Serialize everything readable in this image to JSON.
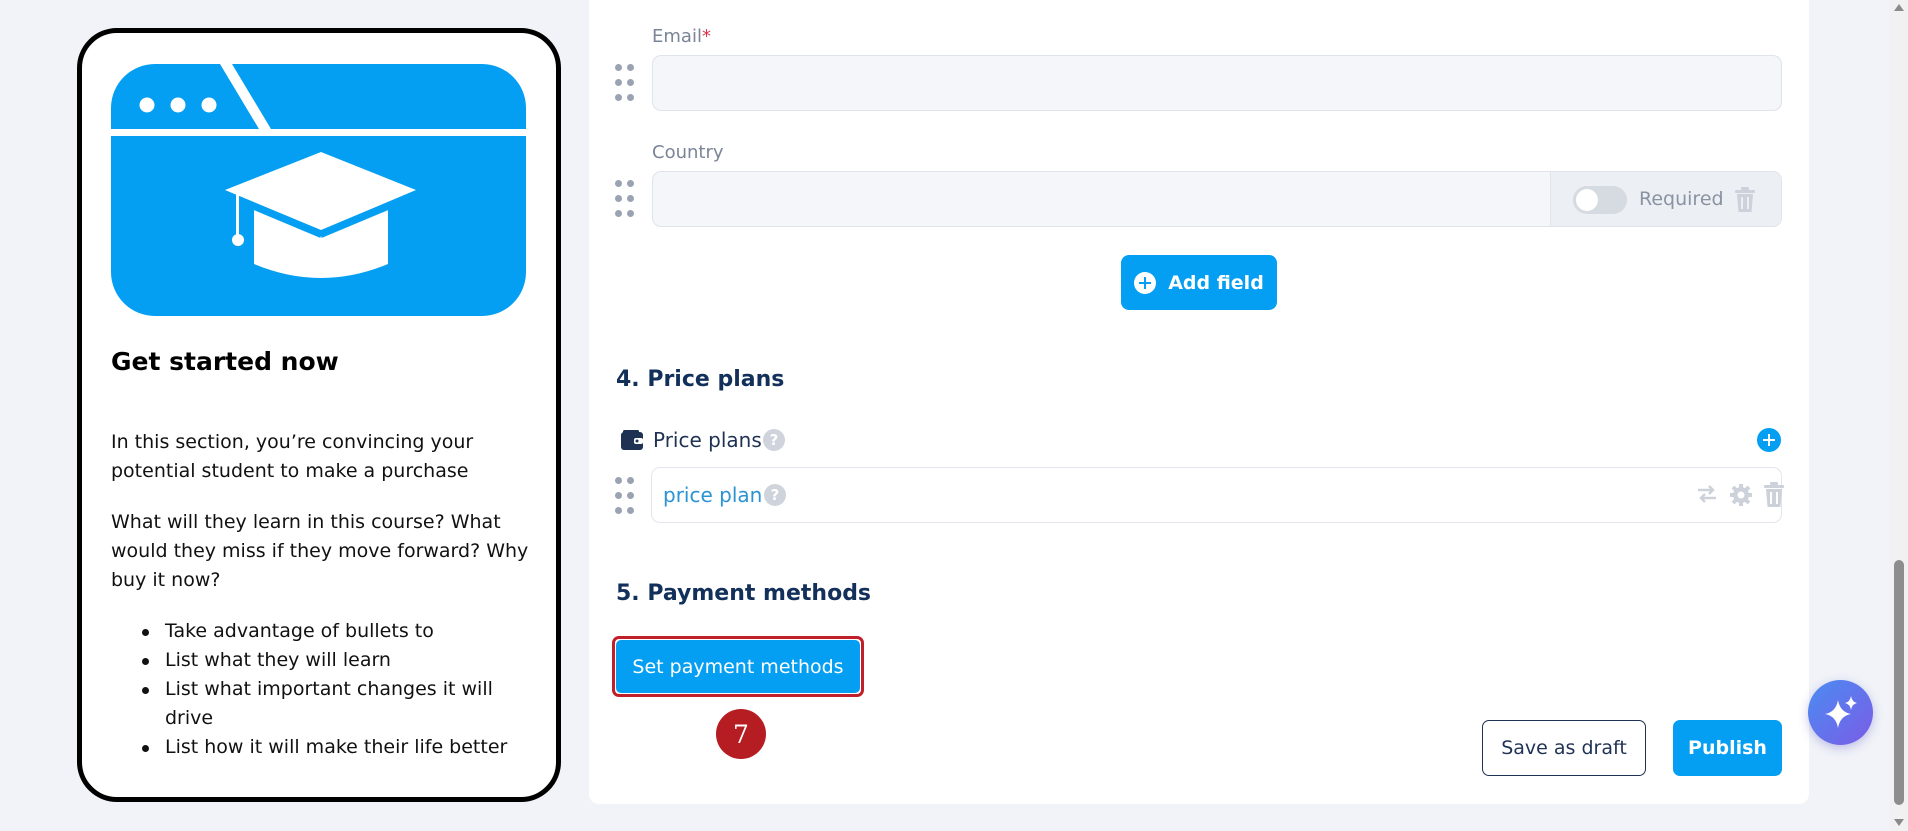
{
  "preview": {
    "title": "Get started now",
    "paragraph_1": "In this section, you’re convincing your potential student to make a purchase",
    "paragraph_2": "What will they learn in this course? What would they miss if they move forward? Why buy it now?",
    "bullets": [
      "Take advantage of bullets to",
      "List what they will learn",
      "List what important changes it will drive",
      "List how it will make their life better"
    ]
  },
  "form": {
    "email": {
      "label": "Email",
      "required_mark": "*",
      "value": ""
    },
    "country": {
      "label": "Country",
      "value": "",
      "required_toggle_label": "Required"
    },
    "add_field_label": "Add field"
  },
  "price_plans": {
    "section_title": "4. Price plans",
    "label": "Price plans",
    "help": "?",
    "plans": [
      {
        "name": "price plan",
        "help": "?"
      }
    ]
  },
  "payment": {
    "section_title": "5. Payment methods",
    "button_label": "Set payment methods",
    "step_badge": "7"
  },
  "actions": {
    "save_draft_label": "Save as draft",
    "publish_label": "Publish"
  },
  "colors": {
    "accent": "#049ff2",
    "highlight": "#c0202a",
    "heading": "#12305a"
  }
}
